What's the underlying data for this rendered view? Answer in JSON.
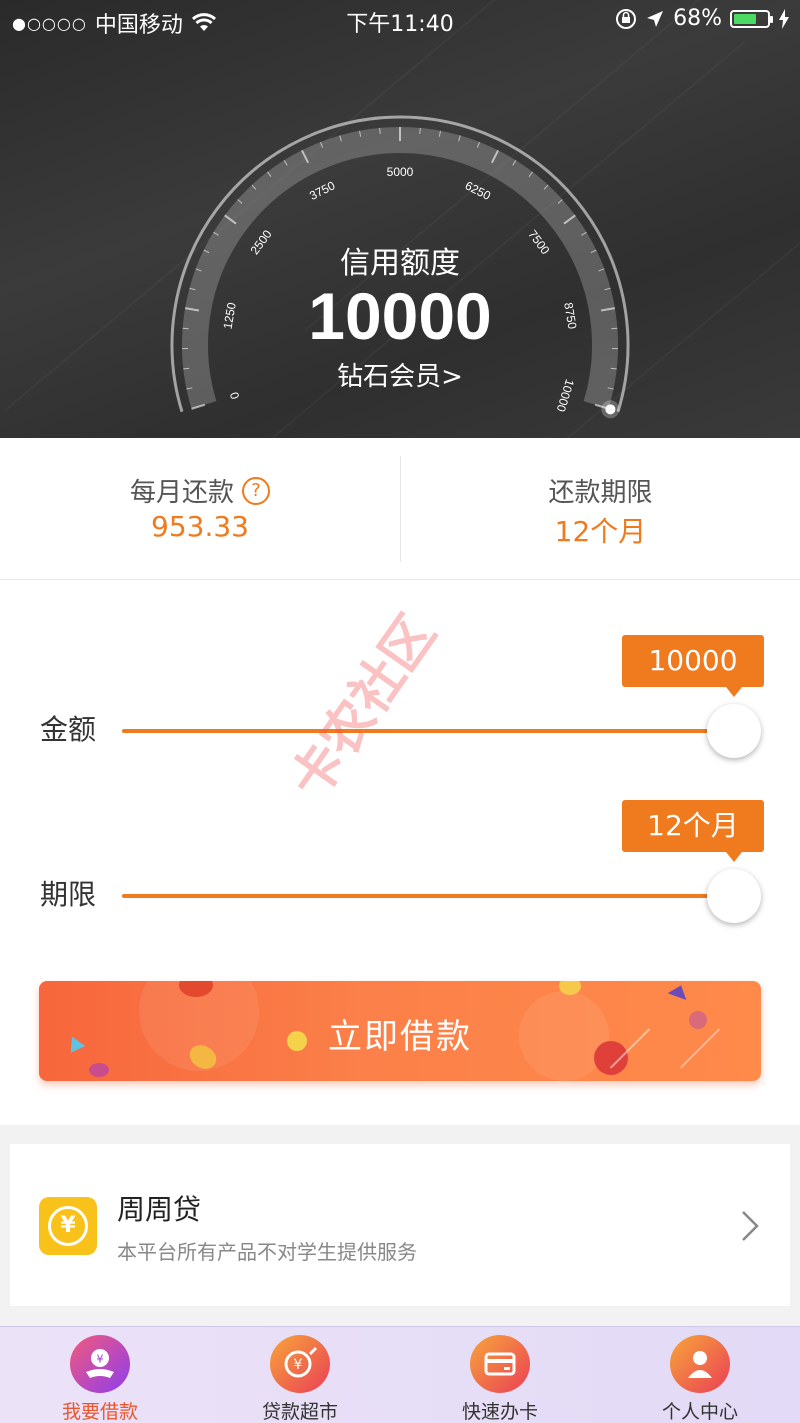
{
  "status_bar": {
    "carrier": "中国移动",
    "signal": "●○○○○",
    "time": "下午11:40",
    "battery": "68%",
    "battery_level": 0.68
  },
  "gauge": {
    "title": "信用额度",
    "value": "10000",
    "member_link": "钻石会员>",
    "ticks": [
      "0",
      "1250",
      "2500",
      "3750",
      "5000",
      "6250",
      "7500",
      "8750",
      "10000"
    ],
    "max": 10000,
    "current": 10000
  },
  "summary": {
    "monthly_label": "每月还款",
    "monthly_value": "953.33",
    "term_label": "还款期限",
    "term_value": "12个月",
    "help_icon": "?"
  },
  "sliders": {
    "amount": {
      "label": "金额",
      "tooltip": "10000",
      "level": 1.0
    },
    "term": {
      "label": "期限",
      "tooltip": "12个月",
      "level": 1.0
    }
  },
  "loan_button": {
    "label": "立即借款"
  },
  "watermark": {
    "text": "卡农社区"
  },
  "product": {
    "name": "周周贷",
    "description": "本平台所有产品不对学生提供服务",
    "icon": "yen-coin-icon",
    "icon_glyph": "¥"
  },
  "tabs": [
    {
      "label": "我要借款",
      "icon": "borrow-icon",
      "active": true
    },
    {
      "label": "贷款超市",
      "icon": "loan-market-icon",
      "active": false
    },
    {
      "label": "快速办卡",
      "icon": "card-icon",
      "active": false
    },
    {
      "label": "个人中心",
      "icon": "profile-icon",
      "active": false
    }
  ],
  "colors": {
    "accent": "#f07a1e",
    "header_bg": "#333333",
    "tab_active": "#e9572e",
    "product_icon": "#f9c21a"
  }
}
